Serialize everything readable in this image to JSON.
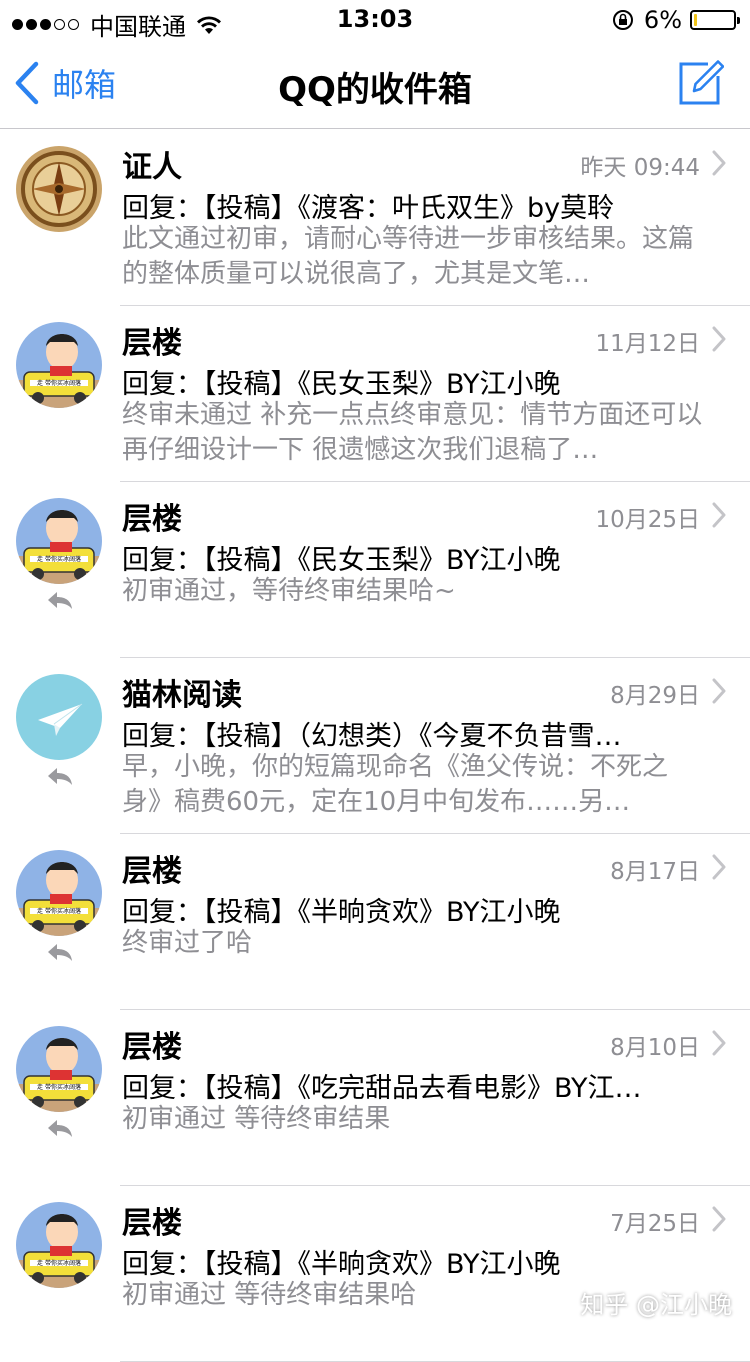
{
  "status_bar": {
    "carrier": "中国联通",
    "time": "13:03",
    "battery_percent": "6%",
    "battery_level": 0.06,
    "signal_bars_filled": 3,
    "signal_bars_total": 5
  },
  "navbar": {
    "back_label": "邮箱",
    "title": "QQ的收件箱",
    "compose_icon": "compose-icon"
  },
  "accent_color": "#2b82f0",
  "emails": [
    {
      "sender": "证人",
      "date": "昨天 09:44",
      "subject": "回复：【投稿】《渡客：叶氏双生》by莫聆",
      "preview": "此文通过初审，请耐心等待进一步审核结果。这篇的整体质量可以说很高了，尤其是文笔…",
      "replied": false,
      "avatar": "compass-avatar"
    },
    {
      "sender": "层楼",
      "date": "11月12日",
      "subject": "回复：【投稿】《民女玉梨》BY江小晚",
      "preview": "终审未通过 补充一点点终审意见：情节方面还可以再仔细设计一下 很遗憾这次我们退稿了…",
      "replied": false,
      "avatar": "cartoon-avatar"
    },
    {
      "sender": "层楼",
      "date": "10月25日",
      "subject": "回复：【投稿】《民女玉梨》BY江小晚",
      "preview": "初审通过，等待终审结果哈~",
      "replied": true,
      "avatar": "cartoon-avatar"
    },
    {
      "sender": "猫林阅读",
      "date": "8月29日",
      "subject": "回复：【投稿】（幻想类）《今夏不负昔雪…",
      "preview": "早，小晚，你的短篇现命名《渔父传说：不死之身》稿费60元，定在10月中旬发布……另…",
      "replied": true,
      "avatar": "paper-plane-avatar"
    },
    {
      "sender": "层楼",
      "date": "8月17日",
      "subject": "回复：【投稿】《半晌贪欢》BY江小晚",
      "preview": "终审过了哈",
      "replied": true,
      "avatar": "cartoon-avatar"
    },
    {
      "sender": "层楼",
      "date": "8月10日",
      "subject": "回复：【投稿】《吃完甜品去看电影》BY江…",
      "preview": "初审通过 等待终审结果",
      "replied": true,
      "avatar": "cartoon-avatar"
    },
    {
      "sender": "层楼",
      "date": "7月25日",
      "subject": "回复：【投稿】《半晌贪欢》BY江小晚",
      "preview": "初审通过 等待终审结果哈",
      "replied": false,
      "avatar": "cartoon-avatar"
    }
  ],
  "watermark": "知乎 @江小晚"
}
